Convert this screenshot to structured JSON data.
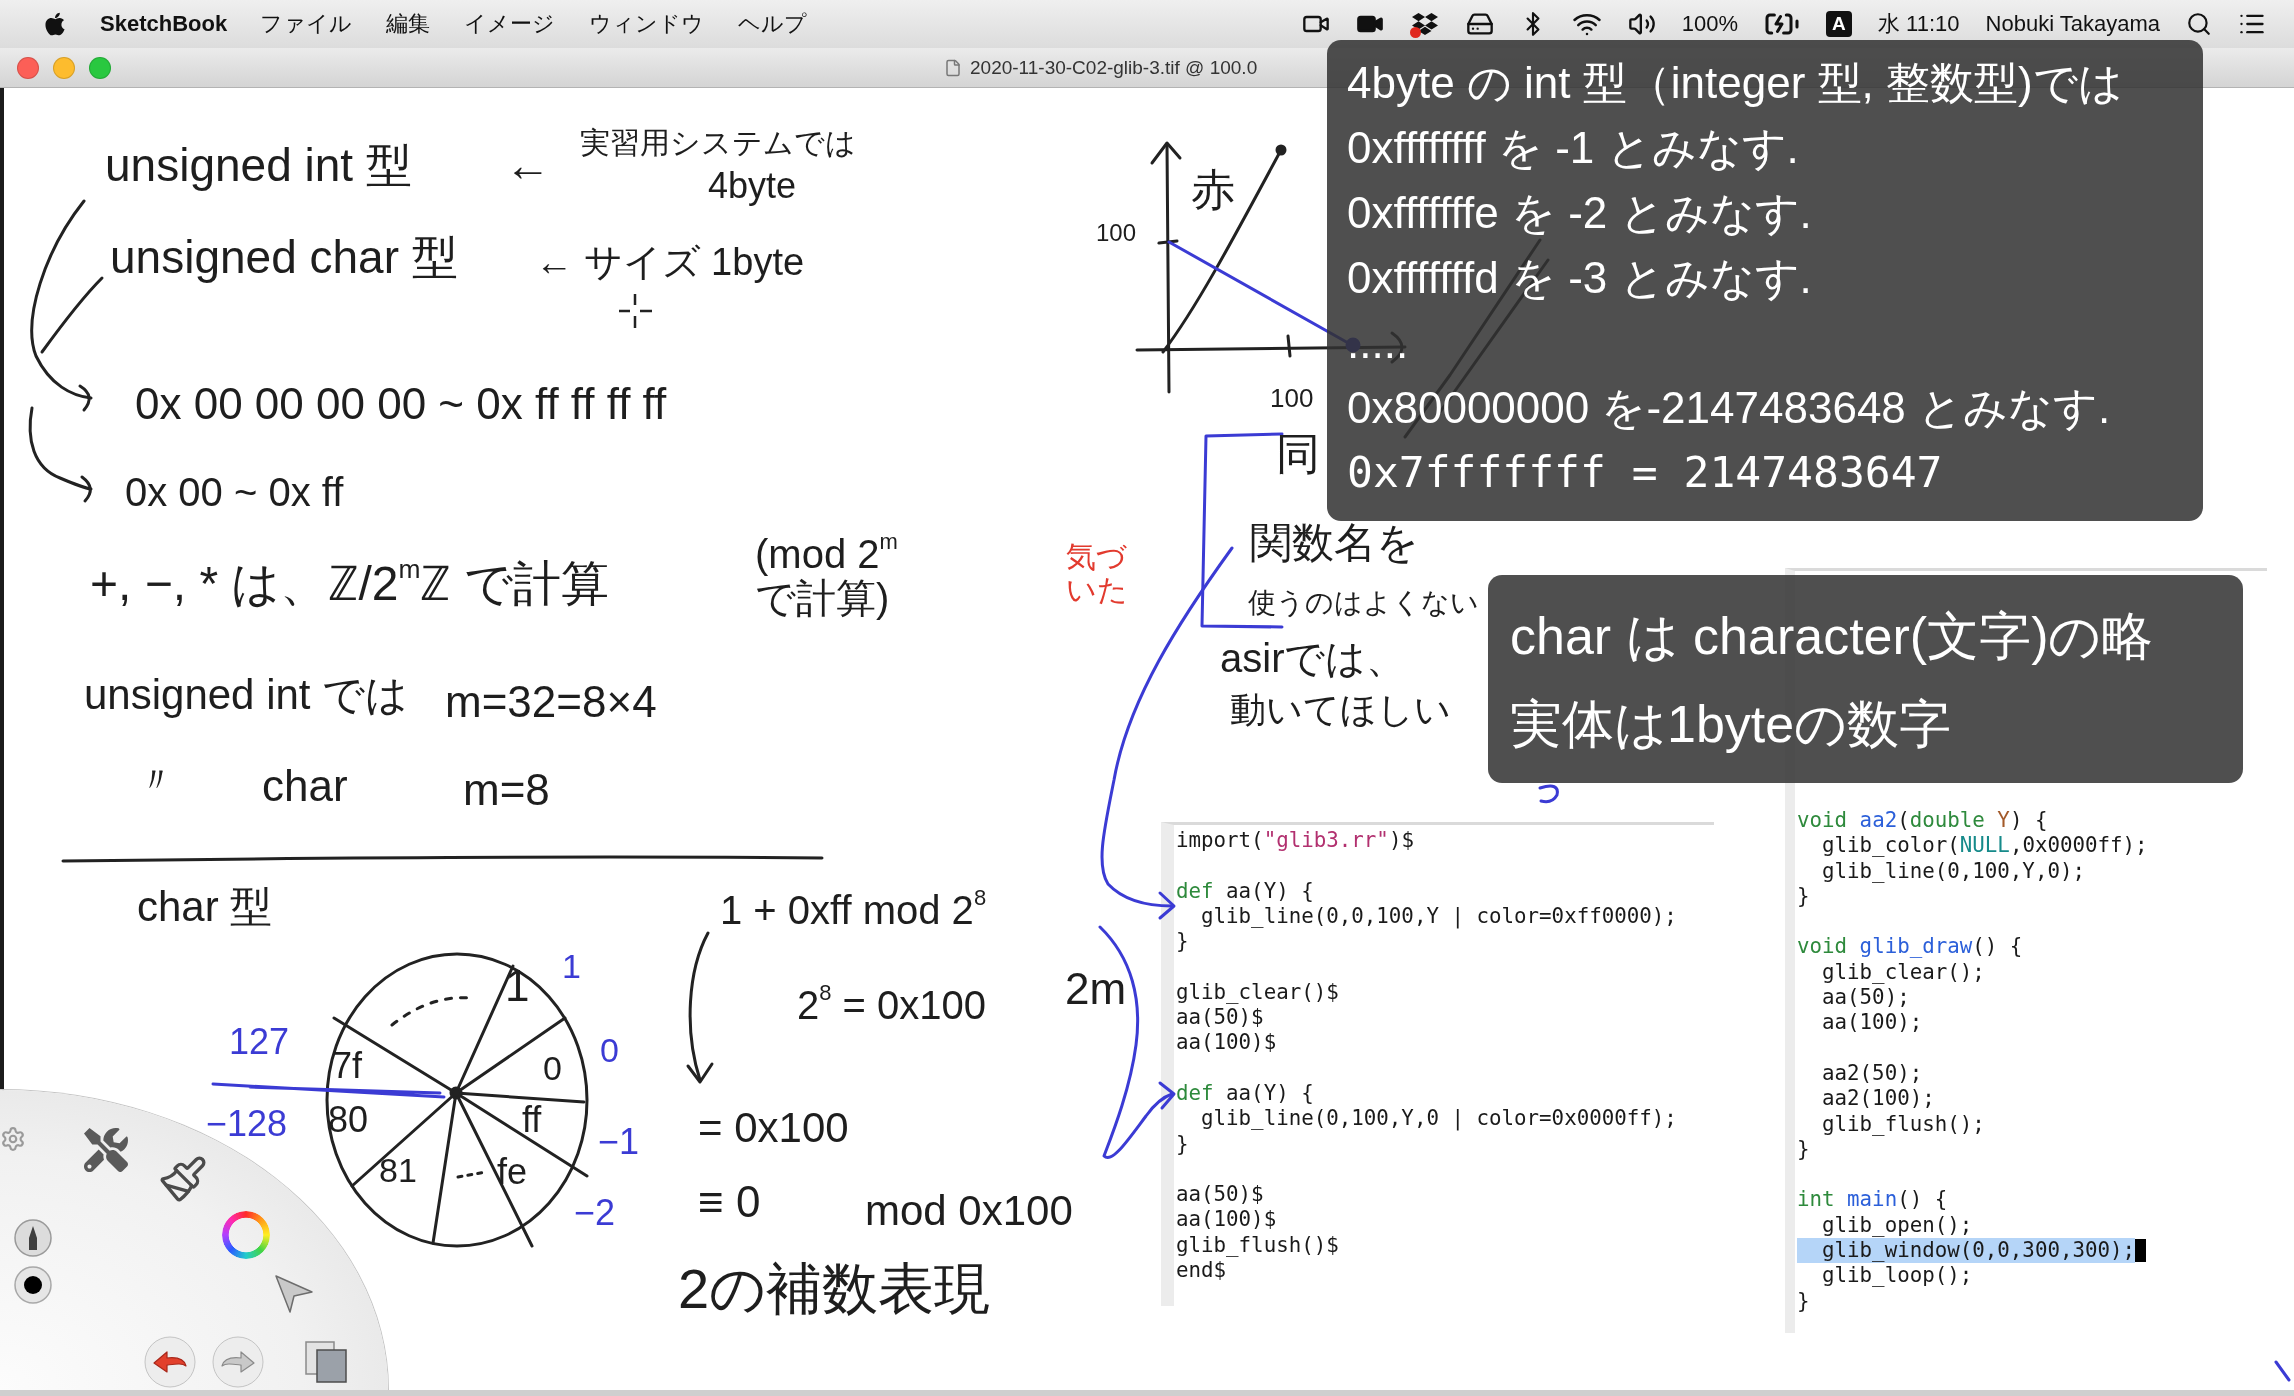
{
  "menu_bar": {
    "app_name": "SketchBook",
    "menus": [
      "ファイル",
      "編集",
      "イメージ",
      "ウィンドウ",
      "ヘルプ"
    ],
    "battery": "100%",
    "input_source": "A",
    "clock": "水 11:10",
    "user": "Nobuki Takayama"
  },
  "window": {
    "title": "2020-11-30-C02-glib-3.tif @ 100.0"
  },
  "canvas": {
    "notes": [
      {
        "text": "unsigned int 型",
        "color": "#1e1e1e"
      },
      {
        "text": "←",
        "color": "#1e1e1e"
      },
      {
        "text": "実習用システムでは",
        "color": "#1e1e1e"
      },
      {
        "text": "4byte",
        "color": "#1e1e1e"
      },
      {
        "text": "unsigned char 型",
        "color": "#1e1e1e"
      },
      {
        "text": "← サイズ 1byte",
        "color": "#1e1e1e"
      },
      {
        "text": "0x 00 00 00 00 ~ 0x ff ff ff ff",
        "color": "#1e1e1e"
      },
      {
        "text": "0x 00 ~ 0x ff",
        "color": "#1e1e1e"
      },
      {
        "text": "+, −, * は、ℤ/2$^{m}$ℤ で計算",
        "color": "#1e1e1e"
      },
      {
        "text": "(mod 2$^{m}$ で計算)",
        "color": "#1e1e1e"
      },
      {
        "text": "unsigned int では",
        "color": "#1e1e1e"
      },
      {
        "text": "m=32=8×4",
        "color": "#1e1e1e"
      },
      {
        "text": "〃",
        "color": "#1e1e1e"
      },
      {
        "text": "char",
        "color": "#1e1e1e"
      },
      {
        "text": "m=8",
        "color": "#1e1e1e"
      },
      {
        "text": "char 型",
        "color": "#1e1e1e"
      },
      {
        "text": "1",
        "color": "#1e1e1e"
      },
      {
        "text": "1",
        "color": "#3b3bd4"
      },
      {
        "text": "127",
        "color": "#3b3bd4"
      },
      {
        "text": "7f",
        "color": "#1e1e1e"
      },
      {
        "text": "0",
        "color": "#1e1e1e"
      },
      {
        "text": "0",
        "color": "#3b3bd4"
      },
      {
        "text": "−128",
        "color": "#3b3bd4"
      },
      {
        "text": "80",
        "color": "#1e1e1e"
      },
      {
        "text": "ff",
        "color": "#1e1e1e"
      },
      {
        "text": "−1",
        "color": "#3b3bd4"
      },
      {
        "text": "81",
        "color": "#1e1e1e"
      },
      {
        "text": "fe",
        "color": "#1e1e1e"
      },
      {
        "text": "−2",
        "color": "#3b3bd4"
      },
      {
        "text": "100",
        "color": "#1e1e1e"
      },
      {
        "text": "赤",
        "color": "#1e1e1e"
      },
      {
        "text": "100",
        "color": "#1e1e1e"
      },
      {
        "text": "同",
        "color": "#1e1e1e"
      },
      {
        "text": "気づいた",
        "color": "#e23a2e"
      },
      {
        "text": "関数名を",
        "color": "#1e1e1e"
      },
      {
        "text": "使うのはよくない",
        "color": "#1e1e1e"
      },
      {
        "text": "asirでは、",
        "color": "#1e1e1e"
      },
      {
        "text": "動いてほしい",
        "color": "#1e1e1e"
      },
      {
        "text": "1 + 0xff mod 2$^{8}$",
        "color": "#1e1e1e"
      },
      {
        "text": "2$^{8}$ = 0x100",
        "color": "#1e1e1e"
      },
      {
        "text": "2m",
        "color": "#1e1e1e"
      },
      {
        "text": "= 0x100",
        "color": "#1e1e1e"
      },
      {
        "text": "≡ 0",
        "color": "#1e1e1e"
      },
      {
        "text": "mod 0x100",
        "color": "#1e1e1e"
      },
      {
        "text": "2の補数表現",
        "color": "#1e1e1e"
      }
    ]
  },
  "code_panels": [
    {
      "blocks": [
        [
          {
            "tokens": [
              "import(",
              {
                "text": "\"glib3.rr\"",
                "kind": "string"
              },
              ")$"
            ]
          }
        ],
        [
          {
            "tokens": [
              {
                "text": "def",
                "kind": "keyword"
              },
              " aa(Y) {"
            ]
          },
          {
            "tokens": [
              "  glib_line(0,0,100,Y | color=0xff0000);"
            ]
          },
          {
            "tokens": [
              "}"
            ]
          }
        ],
        [
          {
            "tokens": [
              "glib_clear()$"
            ]
          },
          {
            "tokens": [
              "aa(50)$"
            ]
          },
          {
            "tokens": [
              "aa(100)$"
            ]
          }
        ],
        [
          {
            "tokens": [
              {
                "text": "def",
                "kind": "keyword"
              },
              " aa(Y) {"
            ]
          },
          {
            "tokens": [
              "  glib_line(0,100,Y,0 | color=0x0000ff);"
            ]
          },
          {
            "tokens": [
              "}"
            ]
          }
        ],
        [
          {
            "tokens": [
              "aa(50)$"
            ]
          },
          {
            "tokens": [
              "aa(100)$"
            ]
          },
          {
            "tokens": [
              "glib_flush()$"
            ]
          },
          {
            "tokens": [
              "end$"
            ]
          }
        ]
      ]
    },
    {
      "blocks": [
        [
          {
            "tokens": [
              {
                "text": "void",
                "kind": "keyword"
              },
              {
                "text": " aa2",
                "kind": "function"
              },
              "(",
              {
                "text": "double",
                "kind": "keyword"
              },
              {
                "text": " Y",
                "kind": "param"
              },
              ") {"
            ],
            "selected": false
          },
          {
            "tokens": [
              "  glib_color(",
              {
                "text": "NULL",
                "kind": "constant"
              },
              ",0x0000ff);"
            ],
            "selected": false
          },
          {
            "tokens": [
              "  glib_line(0,100,Y,0);"
            ],
            "selected": false
          },
          {
            "tokens": [
              "}"
            ],
            "selected": false
          }
        ],
        [
          {
            "tokens": [
              {
                "text": "void",
                "kind": "keyword"
              },
              {
                "text": " glib_draw",
                "kind": "function"
              },
              "() {"
            ],
            "selected": false
          },
          {
            "tokens": [
              "  glib_clear();"
            ],
            "selected": false
          },
          {
            "tokens": [
              "  aa(50);"
            ],
            "selected": false
          },
          {
            "tokens": [
              "  aa(100);"
            ],
            "selected": false
          }
        ],
        [
          {
            "tokens": [
              "  aa2(50);"
            ],
            "selected": false
          },
          {
            "tokens": [
              "  aa2(100);"
            ],
            "selected": false
          },
          {
            "tokens": [
              "  glib_flush();"
            ],
            "selected": false
          },
          {
            "tokens": [
              "}"
            ],
            "selected": false
          }
        ],
        [
          {
            "tokens": [
              {
                "text": "int",
                "kind": "keyword"
              },
              {
                "text": " main",
                "kind": "function"
              },
              "() {"
            ],
            "selected": false
          },
          {
            "tokens": [
              "  glib_open();"
            ],
            "selected": false
          },
          {
            "tokens": [
              "  glib_window(0,0,300,300);"
            ],
            "selected": true
          },
          {
            "tokens": [
              "  glib_loop();"
            ],
            "selected": false
          },
          {
            "tokens": [
              "}"
            ],
            "selected": false
          }
        ]
      ]
    }
  ],
  "subtitles": [
    {
      "lines": [
        {
          "text": "4byte の int 型（integer 型, 整数型)では",
          "kind": "sans"
        },
        {
          "text": "0xffffffff を -1 とみなす.",
          "kind": "sans"
        },
        {
          "text": "0xfffffffe を -2 とみなす.",
          "kind": "sans"
        },
        {
          "text": "0xfffffffd を -3 とみなす.",
          "kind": "sans"
        },
        {
          "text": ".....",
          "kind": "sans"
        },
        {
          "text": "0x80000000 を-2147483648 とみなす.",
          "kind": "sans"
        },
        {
          "text": "0x7fffffff = 2147483647",
          "kind": "mono"
        }
      ]
    },
    {
      "lines": [
        {
          "text": "char は character(文字)の略",
          "kind": "sans"
        },
        {
          "text": "実体は1byteの数字",
          "kind": "sans"
        }
      ]
    }
  ]
}
